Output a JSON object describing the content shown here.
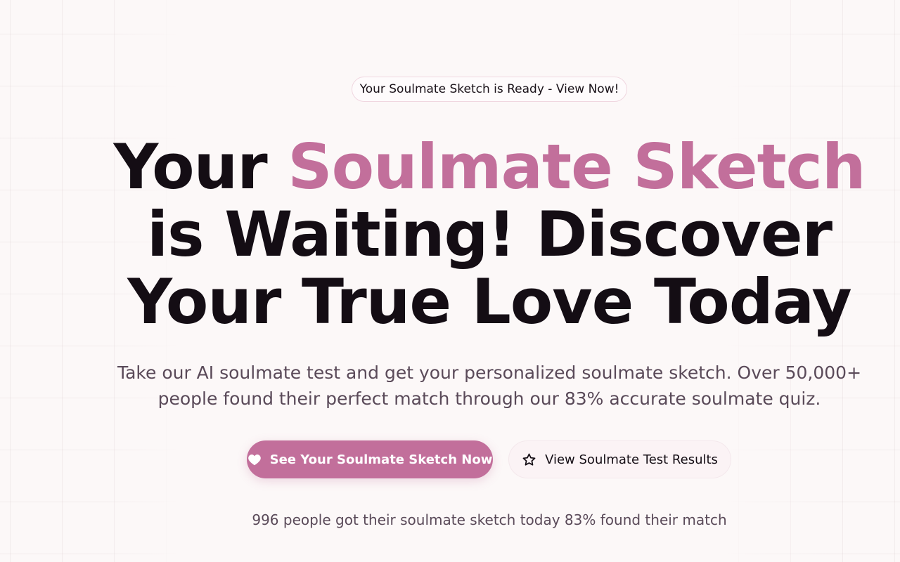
{
  "badge": {
    "text": "Your Soulmate Sketch is Ready - View Now!"
  },
  "hero": {
    "title_prefix": "Your ",
    "title_accent": "Soulmate Sketch",
    "title_rest": " is Waiting! Discover Your True Love Today",
    "subtitle": "Take our AI soulmate test and get your personalized soulmate sketch. Over 50,000+ people found their perfect match through our 83% accurate soulmate quiz."
  },
  "buttons": {
    "primary_label": "See Your Soulmate Sketch Now",
    "primary_icon": "heart-icon",
    "secondary_label": "View Soulmate Test Results",
    "secondary_icon": "star-icon"
  },
  "social_proof": {
    "text": "996 people got their soulmate sketch today 83% found their match"
  },
  "colors": {
    "accent": "#c26f9b",
    "background": "#fcf8f8",
    "text": "#140d14",
    "muted_text": "#5a4a59"
  }
}
